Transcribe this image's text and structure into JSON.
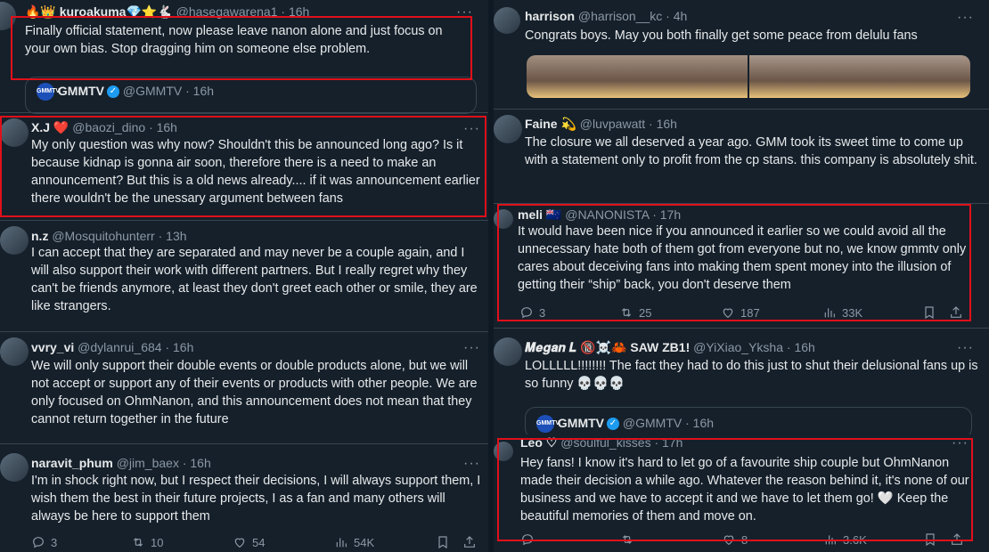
{
  "left": {
    "t1": {
      "name": "🔥👑 kuroakuma💎⭐🐇",
      "handle": "@hasegawarena1",
      "time": "· 16h",
      "text": "Finally official statement, now please leave nanon alone and just focus on your own bias. Stop dragging him on someone else problem.",
      "quote": {
        "logo": "GMMTV",
        "name": "GMMTV",
        "handle": "@GMMTV",
        "time": "· 16h"
      }
    },
    "t2": {
      "name": "X.J ❤️",
      "handle": "@baozi_dino",
      "time": "· 16h",
      "text": "My only question was why now? Shouldn't this be announced long ago? Is it because kidnap is gonna air soon, therefore there is a need to make an announcement? But this is a old news already.... if it was announcement earlier there wouldn't be the unessary argument between fans"
    },
    "t3": {
      "name": "n.z",
      "handle": "@Mosquitohunterr",
      "time": "· 13h",
      "text": "I can accept that they are separated and may never be a couple again, and I will also support their work with different partners. But I really regret why they can't be friends anymore, at least they don't greet each other or smile, they are like strangers."
    },
    "t4": {
      "name": "vvry_vi",
      "handle": "@dylanrui_684",
      "time": "· 16h",
      "text": "We will only support their double events or double products alone, but we will not accept or support any of their events or products with other people. We are only focused on OhmNanon, and this announcement does not mean that they cannot return together in the future"
    },
    "t5": {
      "name": "naravit_phum",
      "handle": "@jim_baex",
      "time": "· 16h",
      "text": "I'm in shock right now, but I respect their decisions, I will always support them, I wish them the best in their future projects, I as a fan and many others will always be here to support them",
      "replies": "3",
      "reposts": "10",
      "likes": "54",
      "views": "54K"
    }
  },
  "right": {
    "t1": {
      "name": "harrison",
      "handle": "@harrison__kc",
      "time": "· 4h",
      "text": "Congrats boys. May you both finally get some peace from delulu fans"
    },
    "t2": {
      "name": "Faine 💫",
      "handle": "@luvpawatt",
      "time": "· 16h",
      "text": "The closure we all deserved a year ago. GMM took its sweet time to come up with a statement only to profit from the cp stans. this company is absolutely shit."
    },
    "t3": {
      "name": "meli 🇳🇿",
      "handle": "@NANONISTA",
      "time": "· 17h",
      "text": "It would have been nice if you announced it earlier so we could avoid all the unnecessary hate both of them got from everyone but no, we know gmmtv only cares about deceiving fans into making them spent money into the illusion of getting their “ship” back, you don't deserve them",
      "replies": "3",
      "reposts": "25",
      "likes": "187",
      "views": "33K"
    },
    "t4": {
      "name": "𝑴𝒆𝒈𝒂𝒏 𝑳 🔞☠️🦀 SAW ZB1!",
      "handle": "@YiXiao_Yksha",
      "time": "· 16h",
      "text": "LOLLLLL!!!!!!!! The fact they had to do this just to shut their delusional fans up is so funny 💀💀💀",
      "quote": {
        "logo": "GMMTV",
        "name": "GMMTV",
        "handle": "@GMMTV",
        "time": "· 16h"
      }
    },
    "t5": {
      "name": "Leo ♡",
      "handle": "@soulful_kisses",
      "time": "· 17h",
      "text": "Hey fans! I know it's hard to let go of a favourite ship couple but OhmNanon made their decision a while ago. Whatever the reason behind it, it's none of our business and we have to accept it and we have to let them go! 🤍 Keep the beautiful memories of them and move on.",
      "likes": "8",
      "views": "3.6K"
    }
  },
  "icons": [
    "reply-icon",
    "repost-icon",
    "like-icon",
    "views-icon",
    "bookmark-icon",
    "share-icon",
    "more-icon",
    "verified-icon"
  ],
  "colors": {
    "bg": "#15202b",
    "text": "#e7e9ea",
    "muted": "#8b98a5",
    "highlight": "#e0101a",
    "verified": "#1d9bf0"
  }
}
